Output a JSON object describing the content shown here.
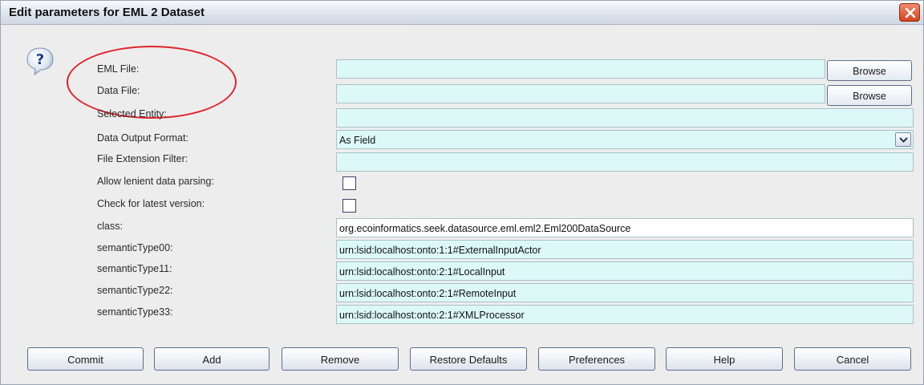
{
  "window": {
    "title": "Edit parameters for EML 2 Dataset"
  },
  "icons": {
    "help": "question-mark-help-icon",
    "close": "close-x-icon",
    "dropdown": "chevron-down-icon"
  },
  "colors": {
    "field_bg": "#ddf9f7",
    "annotation_circle": "#e0242a",
    "close_button": "#d6421e"
  },
  "params": {
    "eml_file": {
      "label": "EML File:",
      "value": "",
      "browse": "Browse"
    },
    "data_file": {
      "label": "Data File:",
      "value": "",
      "browse": "Browse"
    },
    "selected_entity": {
      "label": "Selected Entity:",
      "value": ""
    },
    "data_output_format": {
      "label": "Data Output Format:",
      "value": "As Field"
    },
    "file_extension_filter": {
      "label": "File Extension Filter:",
      "value": ""
    },
    "allow_lenient": {
      "label": "Allow lenient data parsing:",
      "checked": false
    },
    "check_latest": {
      "label": "Check for latest version:",
      "checked": false
    },
    "class": {
      "label": "class:",
      "value": "org.ecoinformatics.seek.datasource.eml.eml2.Eml200DataSource"
    },
    "semantic_types": [
      {
        "label": "semanticType00:",
        "value": "urn:lsid:localhost:onto:1:1#ExternalInputActor"
      },
      {
        "label": "semanticType11:",
        "value": "urn:lsid:localhost:onto:2:1#LocalInput"
      },
      {
        "label": "semanticType22:",
        "value": "urn:lsid:localhost:onto:2:1#RemoteInput"
      },
      {
        "label": "semanticType33:",
        "value": "urn:lsid:localhost:onto:2:1#XMLProcessor"
      }
    ]
  },
  "buttons": {
    "commit": "Commit",
    "add": "Add",
    "remove": "Remove",
    "restore_defaults": "Restore Defaults",
    "preferences": "Preferences",
    "help": "Help",
    "cancel": "Cancel"
  }
}
